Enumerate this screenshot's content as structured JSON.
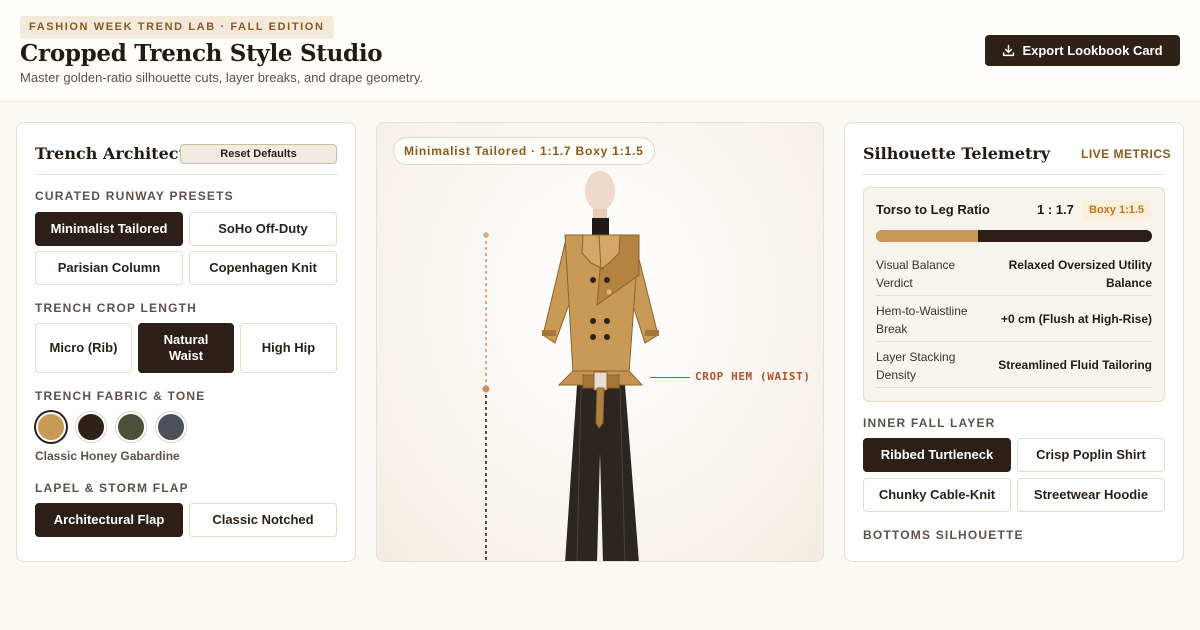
{
  "header": {
    "eyebrow": "FASHION WEEK TREND LAB · FALL EDITION",
    "title": "Cropped Trench Style Studio",
    "subtitle": "Master golden-ratio silhouette cuts, layer breaks, and drape geometry.",
    "export_label": "Export Lookbook Card"
  },
  "left_panel": {
    "title": "Trench Architecture",
    "reset_label": "Reset Defaults",
    "presets_label": "CURATED RUNWAY PRESETS",
    "presets": [
      "Minimalist Tailored",
      "SoHo Off-Duty",
      "Parisian Column",
      "Copenhagen Knit"
    ],
    "crop_label": "TRENCH CROP LENGTH",
    "crops": [
      "Micro (Rib)",
      "Natural Waist",
      "High Hip"
    ],
    "fabric_label": "TRENCH FABRIC & TONE",
    "swatches": [
      {
        "name": "Classic Honey Gabardine",
        "color": "#c99a55"
      },
      {
        "name": "espresso",
        "color": "#2e2118"
      },
      {
        "name": "olive",
        "color": "#4b5138"
      },
      {
        "name": "slate",
        "color": "#4b5059"
      }
    ],
    "swatch_caption": "Classic Honey Gabardine",
    "lapel_label": "LAPEL & STORM FLAP",
    "lapels": [
      "Architectural Flap",
      "Classic Notched"
    ]
  },
  "middle_panel": {
    "ratio_pill": "Minimalist Tailored · 1:1.7 Boxy 1:1.5",
    "crop_hem": "CROP HEM (WAIST)"
  },
  "right_panel": {
    "title": "Silhouette Telemetry",
    "live_label": "LIVE METRICS",
    "ratio_title": "Torso to Leg Ratio",
    "ratio_value": "1 : 1.7",
    "ratio_badge": "Boxy 1:1.5",
    "ratio_fill": 0.37,
    "metrics": [
      {
        "key": "Visual Balance Verdict",
        "value": "Relaxed Oversized Utility Balance"
      },
      {
        "key": "Hem-to-Waistline Break",
        "value": "+0 cm (Flush at High-Rise)"
      },
      {
        "key": "Layer Stacking Density",
        "value": "Streamlined Fluid Tailoring"
      }
    ],
    "inner_label": "INNER FALL LAYER",
    "inner_layers": [
      "Ribbed Turtleneck",
      "Crisp Poplin Shirt",
      "Chunky Cable-Knit",
      "Streetwear Hoodie"
    ],
    "bottoms_label": "BOTTOMS SILHOUETTE"
  },
  "colors": {
    "accent": "#8a5a1e",
    "dark": "#2b1f17",
    "camel": "#c99a55",
    "crop_marker": "#b3502d"
  }
}
